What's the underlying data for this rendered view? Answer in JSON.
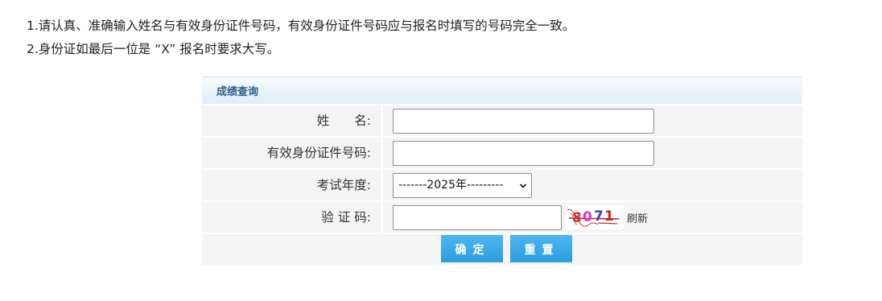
{
  "notes": [
    "1.请认真、准确输入姓名与有效身份证件号码，有效身份证件号码应与报名时填写的号码完全一致。",
    "2.身份证如最后一位是 “X” 报名时要求大写。"
  ],
  "form": {
    "title": "成绩查询",
    "name_label": "姓　　名:",
    "name_value": "",
    "id_label": "有效身份证件号码:",
    "id_value": "",
    "year_label": "考试年度:",
    "year_selected": "-------2025年---------",
    "captcha_label": "验 证 码:",
    "captcha_value": "",
    "captcha_text": "8071",
    "refresh_label": "刷新",
    "submit_label": "确定",
    "reset_label": "重置"
  },
  "colors": {
    "button": "#2c9de0",
    "header_text": "#2b5a88",
    "row_bg": "#f4f4f4"
  }
}
